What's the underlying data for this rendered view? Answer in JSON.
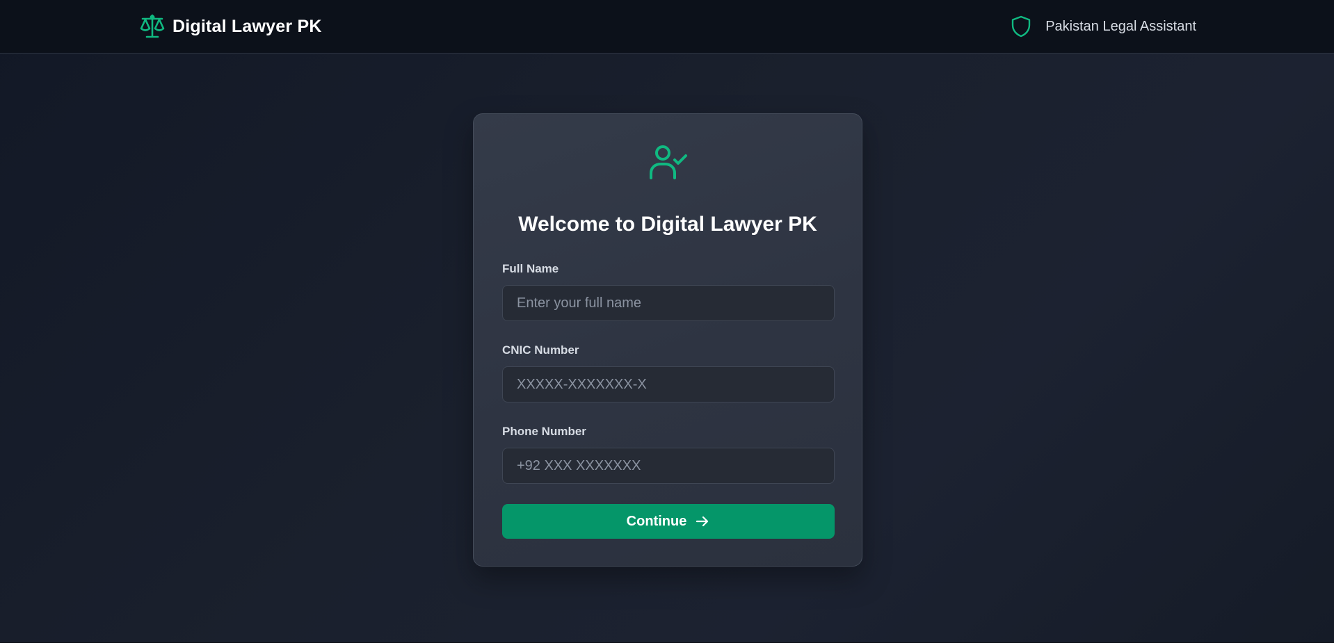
{
  "header": {
    "title": "Digital Lawyer PK",
    "tagline": "Pakistan Legal Assistant",
    "logo_icon": "scale-icon",
    "tagline_icon": "shield-icon"
  },
  "login_card": {
    "icon": "user-check-icon",
    "title": "Welcome to Digital Lawyer PK",
    "fields": [
      {
        "label": "Full Name",
        "placeholder": "Enter your full name",
        "value": ""
      },
      {
        "label": "CNIC Number",
        "placeholder": "XXXXX-XXXXXXX-X",
        "value": ""
      },
      {
        "label": "Phone Number",
        "placeholder": "+92 XXX XXXXXXX",
        "value": ""
      }
    ],
    "submit_label": "Continue",
    "submit_icon": "arrow-right-icon"
  },
  "colors": {
    "accent": "#10b981",
    "button": "#059669",
    "nav_bg": "#0c111a",
    "page_bg": "#1a202d",
    "card_bg": "#313845",
    "input_bg": "#262b35"
  }
}
